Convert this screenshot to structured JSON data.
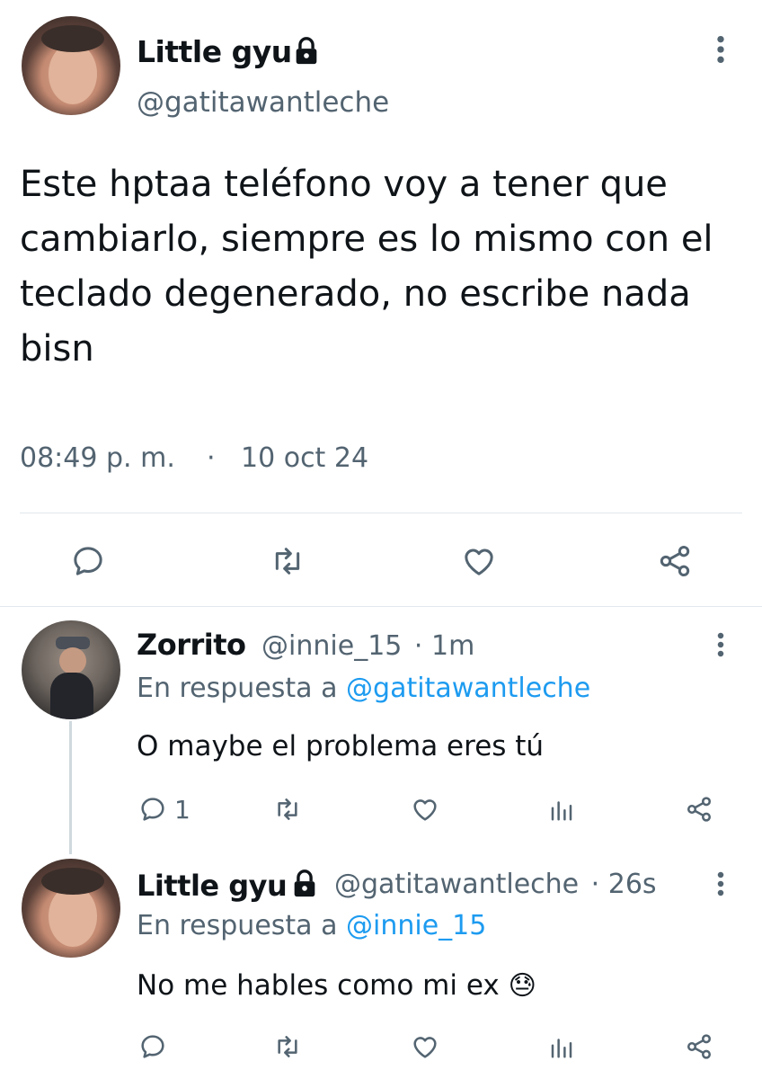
{
  "main_tweet": {
    "author_name": "Little gyu",
    "author_handle": "@gatitawantleche",
    "text": "Este hptaa teléfono voy a tener que cambiarlo, siempre es lo mismo con el teclado degenerado, no escribe nada bisn",
    "time": "08:49 p. m.",
    "separator": "·",
    "date": "10 oct 24"
  },
  "reply_1": {
    "author_name": "Zorrito",
    "author_handle": "@innie_15",
    "age": "· 1m",
    "replying_prefix": "En respuesta a",
    "replying_to": "@gatitawantleche",
    "text": "O maybe el problema eres tú",
    "reply_count": "1"
  },
  "reply_2": {
    "author_name": "Little gyu",
    "author_handle": "@gatitawantleche",
    "age": "· 26s",
    "replying_prefix": "En respuesta a",
    "replying_to": "@innie_15",
    "text": "No me hables como mi ex",
    "emoji": "😓"
  },
  "icons": {
    "lock": "lock-icon",
    "more": "more-vertical-icon",
    "reply": "reply-icon",
    "retweet": "retweet-icon",
    "like": "heart-icon",
    "share": "share-icon",
    "views": "views-icon"
  },
  "colors": {
    "text": "#0f1419",
    "secondary": "#536471",
    "link": "#1d9bf0",
    "divider": "#e1e8ed"
  }
}
